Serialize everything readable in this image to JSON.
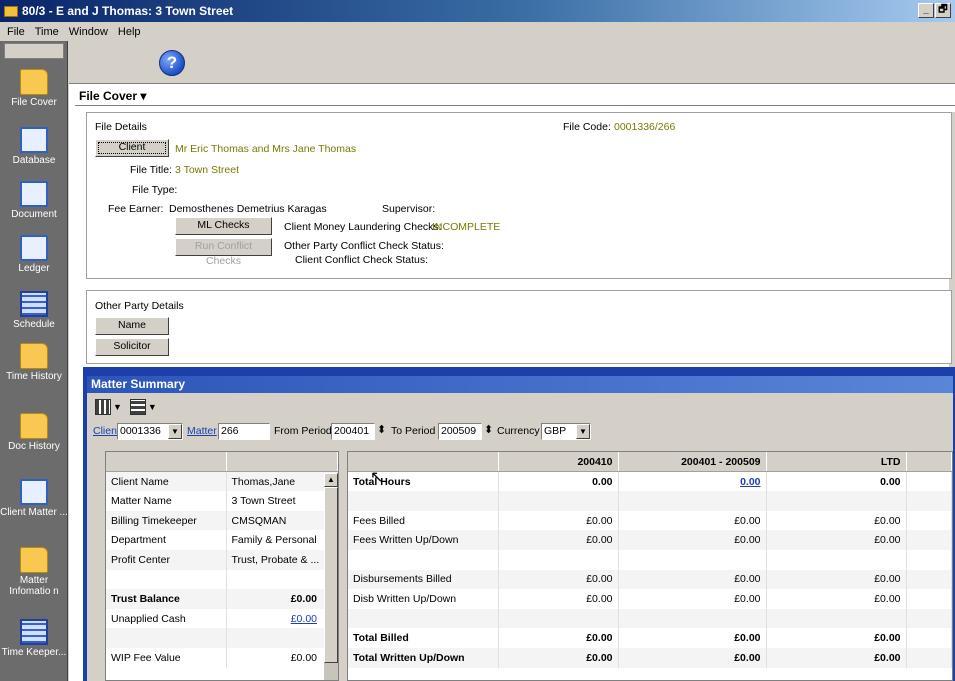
{
  "window": {
    "title": "80/3 - E and J Thomas: 3 Town Street",
    "minimize": "_",
    "restore": "🗗"
  },
  "menu": [
    "File",
    "Time",
    "Window",
    "Help"
  ],
  "sidebar": {
    "items": [
      {
        "label": "File Cover",
        "icon": "folder-icon"
      },
      {
        "label": "Database",
        "icon": "database-icon"
      },
      {
        "label": "Document",
        "icon": "document-icon"
      },
      {
        "label": "Ledger",
        "icon": "ledger-icon"
      },
      {
        "label": "Schedule",
        "icon": "schedule-icon"
      },
      {
        "label": "Time History",
        "icon": "time-history-icon"
      },
      {
        "label": "Doc History",
        "icon": "doc-history-icon"
      },
      {
        "label": "Client Matter ...",
        "icon": "client-matter-icon"
      },
      {
        "label": "Matter Infomatio n",
        "icon": "matter-info-icon"
      },
      {
        "label": "Time Keeper...",
        "icon": "time-keeper-icon"
      }
    ]
  },
  "toolbar": {
    "help": "?"
  },
  "file_cover": {
    "header": "File Cover ▾",
    "details_title": "File Details",
    "client_btn": "Client",
    "client_value": "Mr Eric Thomas and Mrs Jane Thomas",
    "file_code_label": "File Code:",
    "file_code": "0001336/266",
    "file_title_label": "File Title:",
    "file_title": "3 Town Street",
    "file_type_label": "File Type:",
    "fee_earner_label": "Fee Earner:",
    "fee_earner": "Demosthenes Demetrius Karagas",
    "supervisor_label": "Supervisor:",
    "ml_btn": "ML Checks",
    "ml_label": "Client Money Laundering Checks:",
    "ml_status": "INCOMPLETE",
    "conflict_btn": "Run Conflict Checks",
    "other_party_conflict": "Other Party Conflict Check Status:",
    "client_conflict": "Client Conflict Check Status:",
    "other_party_title": "Other Party Details",
    "name_btn": "Name",
    "solicitor_btn": "Solicitor"
  },
  "matter_summary": {
    "title": "Matter Summary",
    "client_label": "Client",
    "client_value": "0001336",
    "matter_label": "Matter",
    "matter_value": "266",
    "from_label": "From Period",
    "from_value": "200401",
    "to_label": "To Period",
    "to_value": "200509",
    "currency_label": "Currency",
    "currency_value": "GBP",
    "left_rows": [
      [
        "Client Name",
        "Thomas,Jane"
      ],
      [
        "Matter Name",
        "3 Town Street"
      ],
      [
        "Billing Timekeeper",
        "CMSQMAN"
      ],
      [
        "Department",
        "Family & Personal"
      ],
      [
        "Profit Center",
        "Trust, Probate & ..."
      ],
      [
        "",
        ""
      ],
      [
        "Trust Balance",
        "£0.00"
      ],
      [
        "Unapplied Cash",
        "£0.00"
      ],
      [
        "",
        ""
      ],
      [
        "WIP Fee Value",
        "£0.00"
      ]
    ],
    "right_headers": [
      "",
      "200410",
      "200401 - 200509",
      "LTD"
    ],
    "right_rows": [
      [
        "Total Hours",
        "0.00",
        "0.00",
        "0.00"
      ],
      [
        "",
        "",
        "",
        ""
      ],
      [
        "Fees Billed",
        "£0.00",
        "£0.00",
        "£0.00"
      ],
      [
        "Fees Written Up/Down",
        "£0.00",
        "£0.00",
        "£0.00"
      ],
      [
        "",
        "",
        "",
        ""
      ],
      [
        "Disbursements Billed",
        "£0.00",
        "£0.00",
        "£0.00"
      ],
      [
        "Disb Written Up/Down",
        "£0.00",
        "£0.00",
        "£0.00"
      ],
      [
        "",
        "",
        "",
        ""
      ],
      [
        "Total Billed",
        "£0.00",
        "£0.00",
        "£0.00"
      ],
      [
        "Total Written Up/Down",
        "£0.00",
        "£0.00",
        "£0.00"
      ]
    ]
  }
}
